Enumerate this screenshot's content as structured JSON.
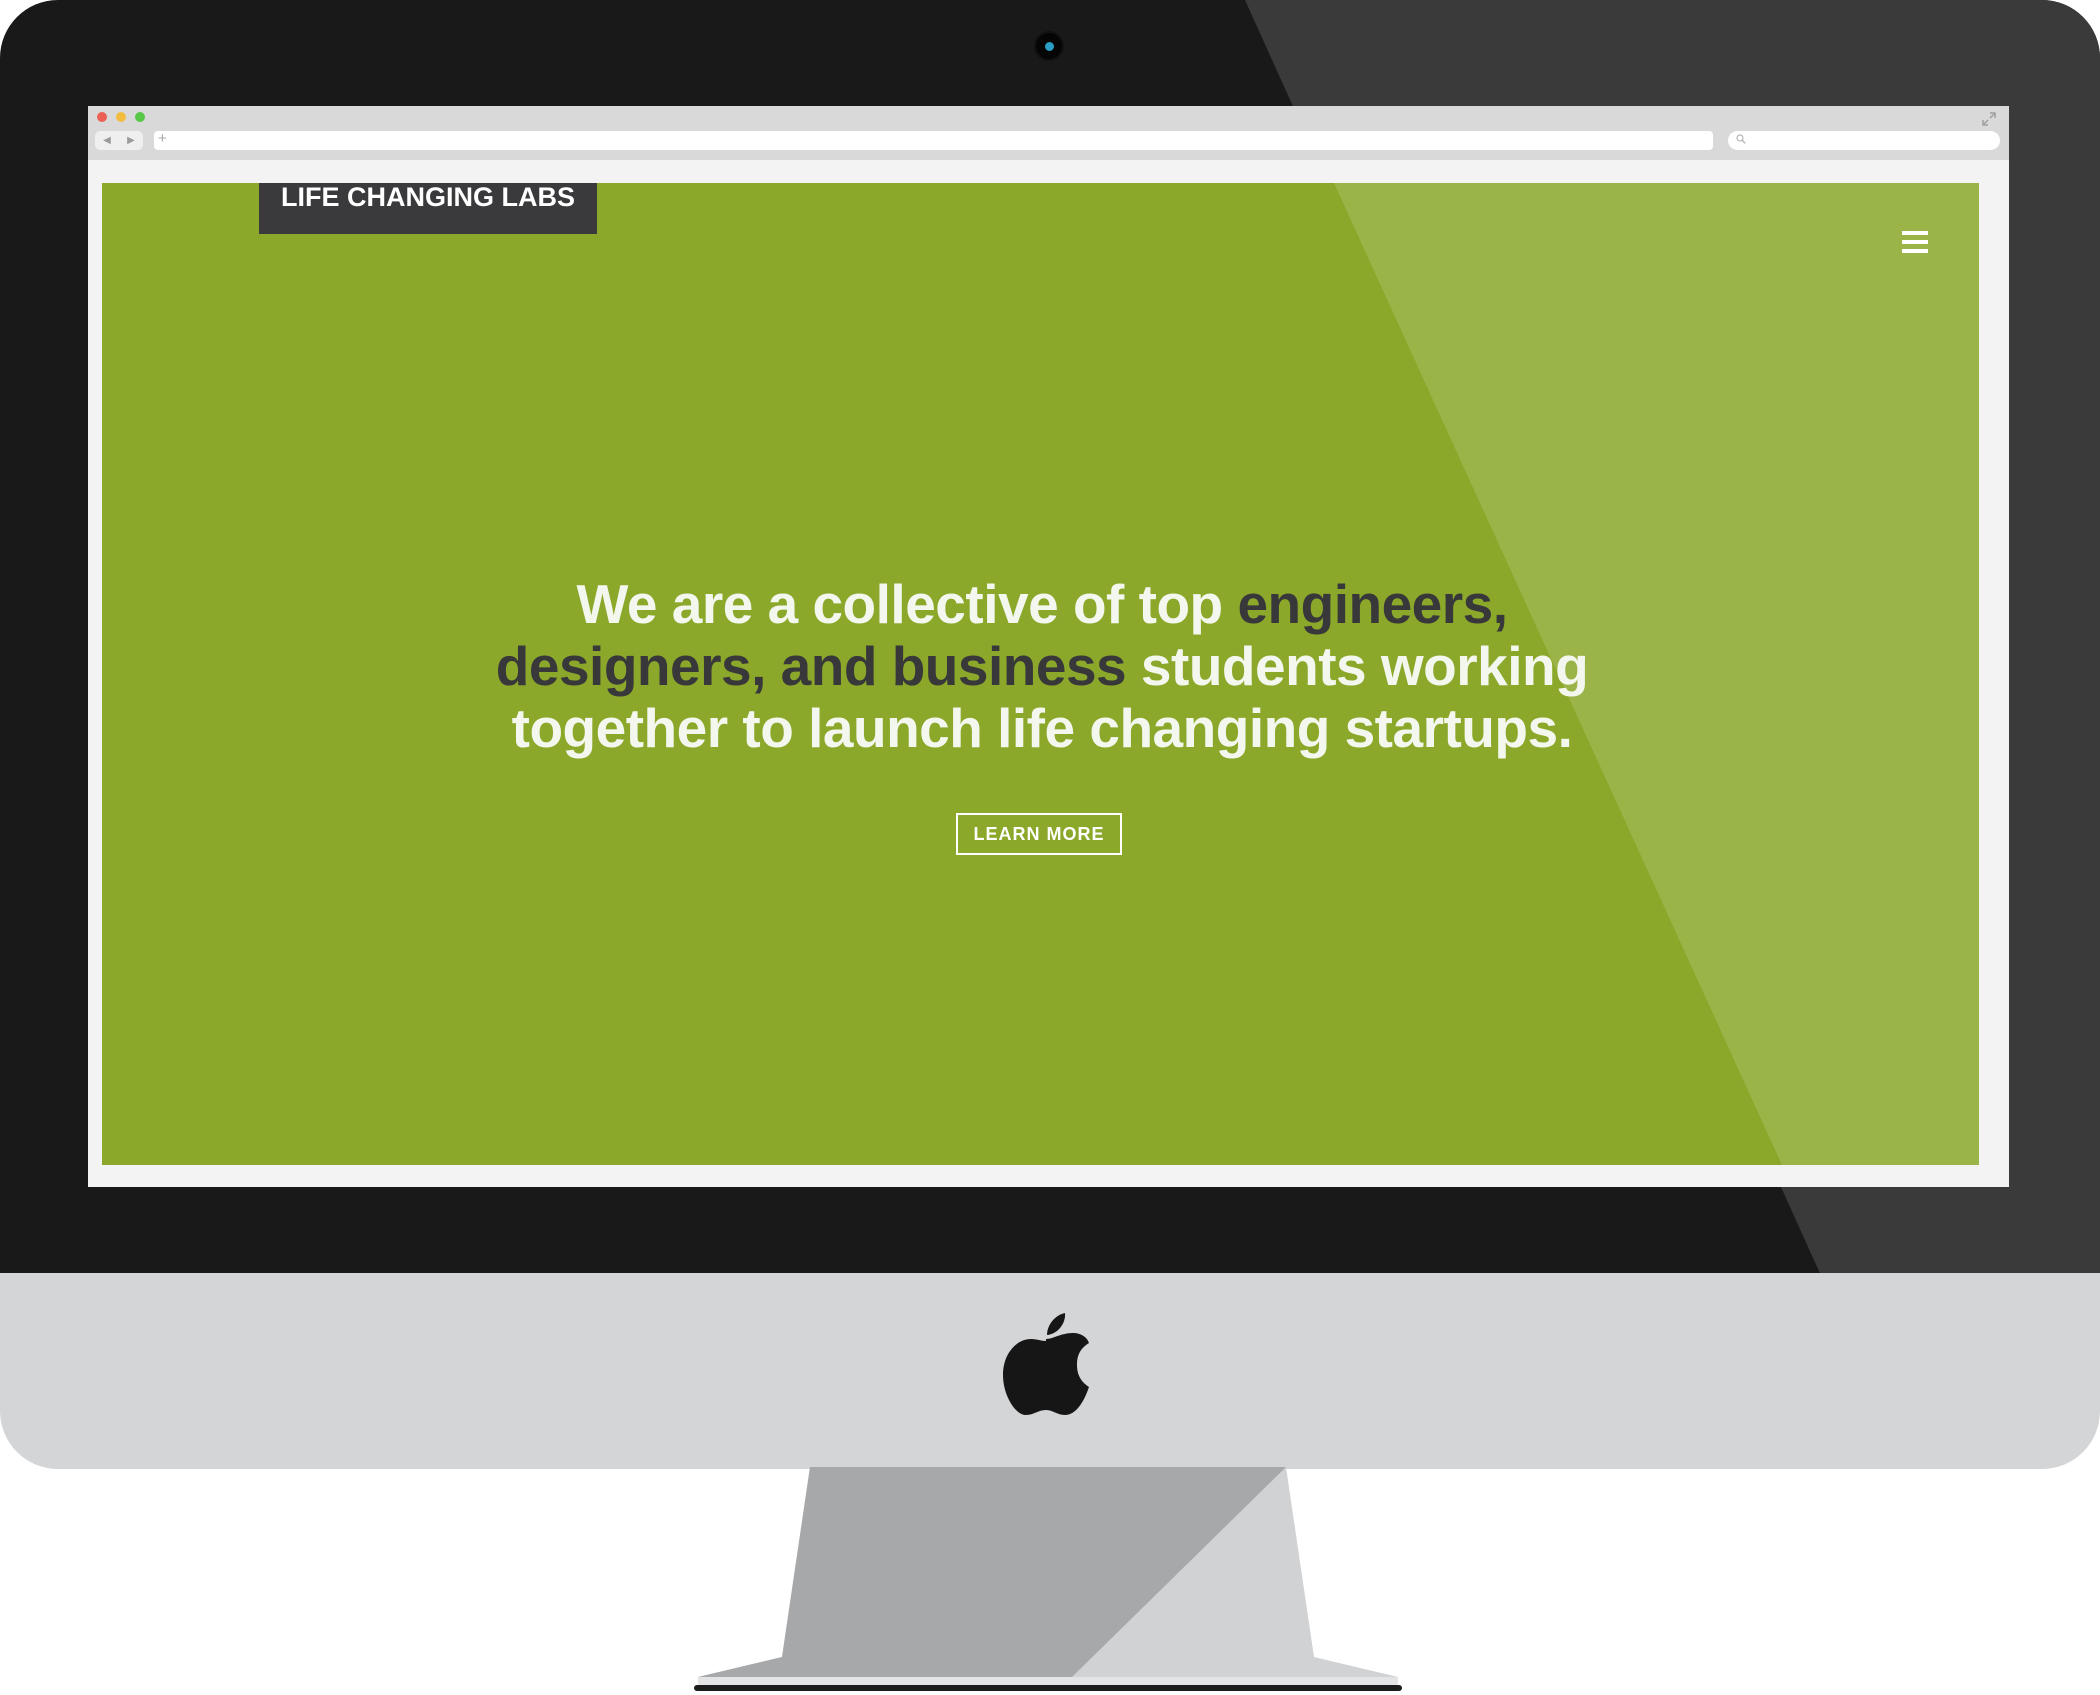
{
  "brand": {
    "name": "LIFE CHANGING LABS"
  },
  "hero": {
    "headline_lead": "We are a collective of top ",
    "headline_emphasis": "engineers, designers, and business",
    "headline_tail": " students working together to launch life changing startups.",
    "cta_label": "LEARN MORE"
  },
  "browser": {
    "back_glyph": "◀",
    "forward_glyph": "▶",
    "add_tab_glyph": "+"
  },
  "icons": {
    "menu": "hamburger-menu-icon",
    "search": "search-icon",
    "expand": "expand-icon",
    "device_logo": "apple-logo-icon"
  },
  "colors": {
    "hero_green": "#8ba82b",
    "brand_box": "#3a3a3c",
    "emphasis_text": "#38383a",
    "bezel": "#191919",
    "chin": "#d4d5d7"
  }
}
